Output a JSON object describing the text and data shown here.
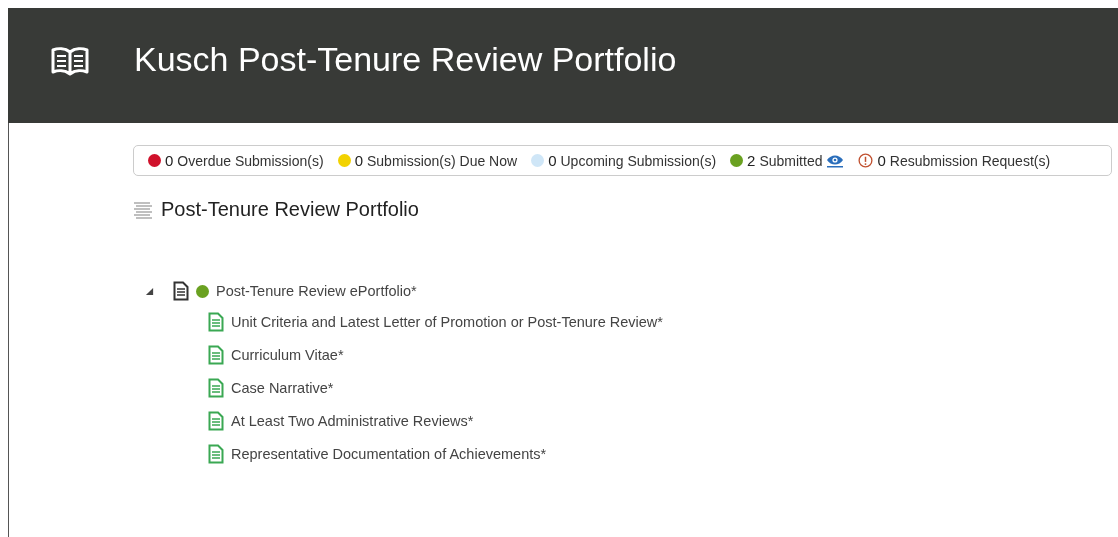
{
  "header": {
    "title": "Kusch Post-Tenure Review Portfolio"
  },
  "status_summary": [
    {
      "kind": "dot",
      "color": "#d0112b",
      "count": "0",
      "label": "Overdue Submission(s)"
    },
    {
      "kind": "dot",
      "color": "#f2d200",
      "count": "0",
      "label": "Submission(s) Due Now"
    },
    {
      "kind": "dot",
      "color": "#cfe6f7",
      "count": "0",
      "label": "Upcoming Submission(s)"
    },
    {
      "kind": "dot",
      "color": "#6aa121",
      "count": "2",
      "label": "Submitted",
      "view_link": true
    },
    {
      "kind": "alert",
      "count": "0",
      "label": "Resubmission Request(s)"
    }
  ],
  "section": {
    "title": "Post-Tenure Review Portfolio"
  },
  "tree": [
    {
      "label": "Post-Tenure Review ePortfolio*",
      "color": "#6aa121",
      "expanded": true,
      "children": [
        {
          "label": "Unit Criteria and Latest Letter of Promotion or Post-Tenure Review*"
        },
        {
          "label": "Curriculum Vitae*"
        },
        {
          "label": "Case Narrative*"
        },
        {
          "label": "At Least Two Administrative Reviews*"
        },
        {
          "label": "Representative Documentation of Achievements*"
        }
      ]
    }
  ]
}
